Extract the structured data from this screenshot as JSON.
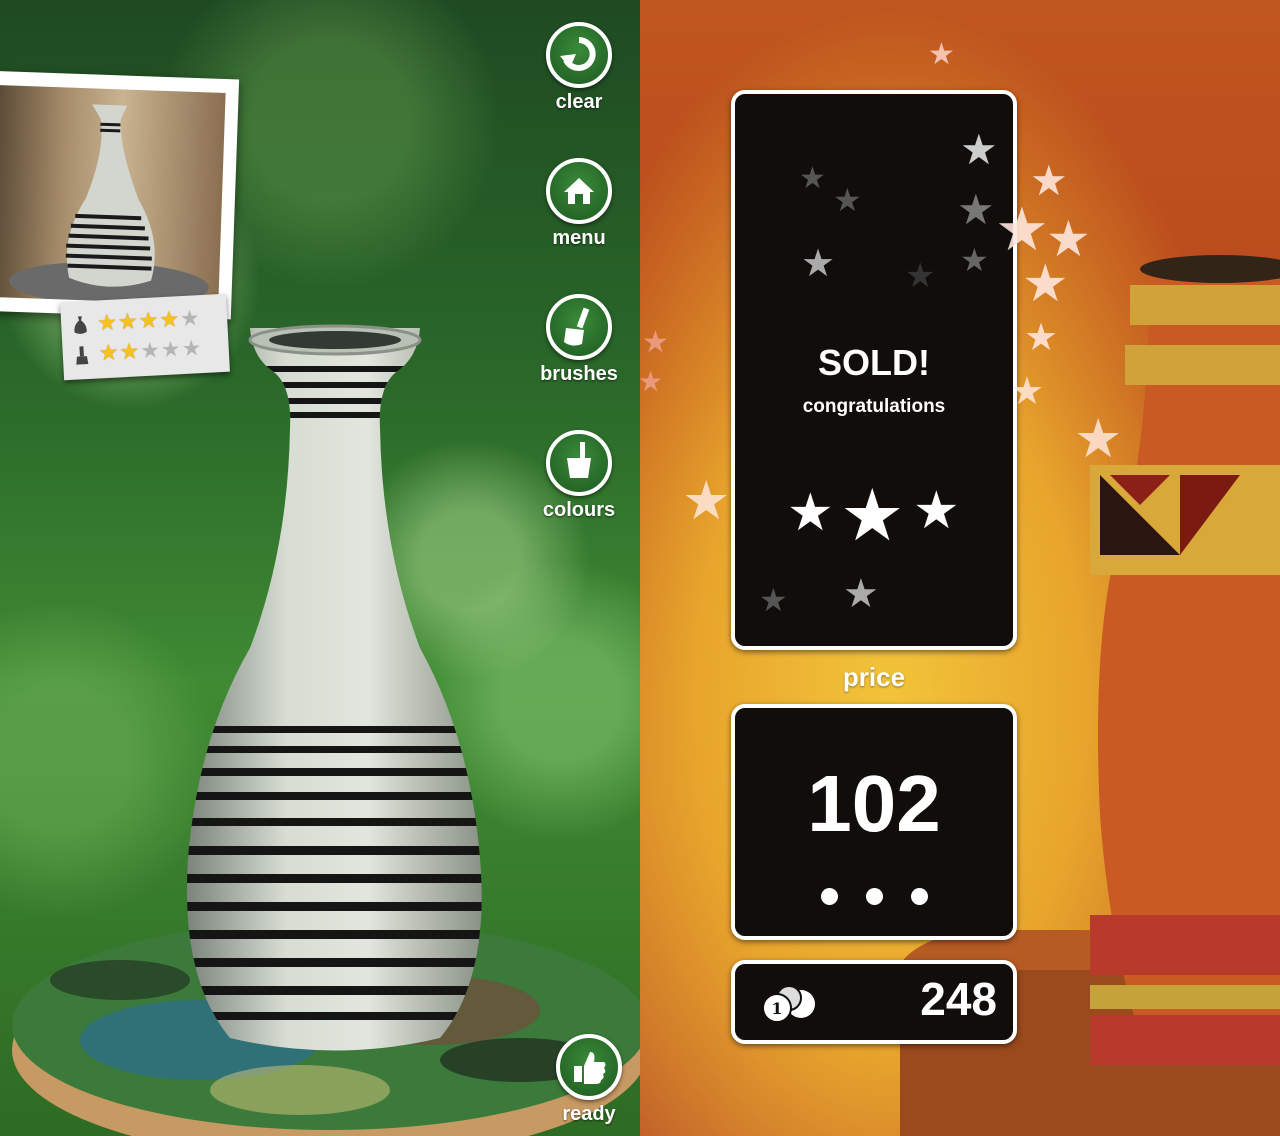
{
  "sidebar": {
    "clear_label": "clear",
    "menu_label": "menu",
    "brushes_label": "brushes",
    "colours_label": "colours",
    "ready_label": "ready"
  },
  "rating_card": {
    "shape_stars": 4,
    "paint_stars": 2,
    "max_stars": 5
  },
  "sale_panel": {
    "title": "SOLD!",
    "subtitle": "congratulations",
    "stars_awarded": 3
  },
  "price": {
    "label": "price",
    "value": "102",
    "dots": 3
  },
  "coins": {
    "value": "248"
  },
  "colors": {
    "left_bg": "#2b6a2a",
    "right_bg": "#c0561f",
    "panel_bg": "#110d0a",
    "star_yellow": "#f7c21b"
  }
}
